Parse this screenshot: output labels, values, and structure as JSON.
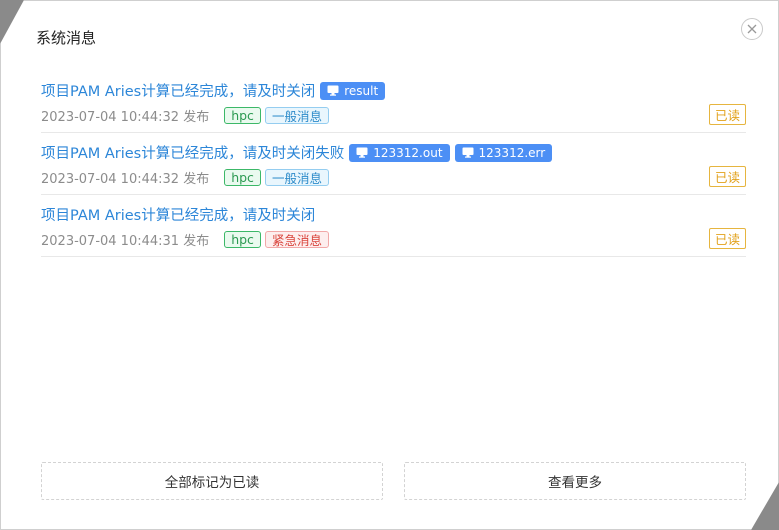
{
  "dialog": {
    "title": "系统消息"
  },
  "messages": [
    {
      "title": "项目PAM Aries计算已经完成，请及时关闭",
      "files": [
        "result"
      ],
      "time": "2023-07-04 10:44:32 发布",
      "tags": [
        {
          "label": "hpc",
          "kind": "hpc"
        },
        {
          "label": "一般消息",
          "kind": "general"
        }
      ],
      "status": "已读"
    },
    {
      "title": "项目PAM Aries计算已经完成，请及时关闭失败",
      "files": [
        "123312.out",
        "123312.err"
      ],
      "time": "2023-07-04 10:44:32 发布",
      "tags": [
        {
          "label": "hpc",
          "kind": "hpc"
        },
        {
          "label": "一般消息",
          "kind": "general"
        }
      ],
      "status": "已读"
    },
    {
      "title": "项目PAM Aries计算已经完成，请及时关闭",
      "files": [],
      "time": "2023-07-04 10:44:31 发布",
      "tags": [
        {
          "label": "hpc",
          "kind": "hpc"
        },
        {
          "label": "紧急消息",
          "kind": "urgent"
        }
      ],
      "status": "已读"
    }
  ],
  "footer": {
    "mark_all_label": "全部标记为已读",
    "more_label": "查看更多"
  },
  "colors": {
    "link": "#2c86d8",
    "file_button": "#4c8ff5",
    "read_badge": "#e2a21c"
  },
  "icons": {
    "close": "close-icon",
    "file": "monitor-icon"
  }
}
